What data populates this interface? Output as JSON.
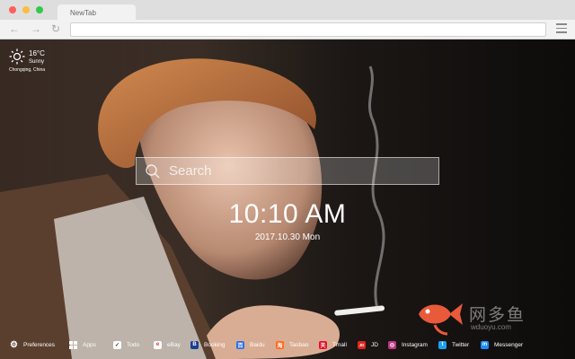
{
  "browser": {
    "tab_title": "NewTab",
    "nav": {
      "back": "←",
      "forward": "→",
      "reload": "↻"
    },
    "url": ""
  },
  "weather": {
    "temperature": "16°C",
    "condition": "Sunny",
    "location": "Chongqing,  China"
  },
  "search": {
    "placeholder": "Search"
  },
  "clock": {
    "time": "10:10 AM",
    "date": "2017.10.30 Mon"
  },
  "watermark": {
    "text": "网多鱼",
    "sub": "wduoyu.com",
    "colors": {
      "fish": "#e85a3a"
    }
  },
  "bottom_bar": {
    "items": [
      {
        "label": "Preferences",
        "icon": "gear-icon",
        "color": "transparent",
        "glyph": "⚙"
      },
      {
        "label": "Apps",
        "icon": "grid-icon",
        "color": "transparent",
        "glyph": ""
      },
      {
        "label": "Todo",
        "icon": "checkbox-icon",
        "color": "#ffffff",
        "glyph": "✓"
      },
      {
        "label": "eBay",
        "icon": "ebay-icon",
        "color": "#ffffff",
        "glyph": "e"
      },
      {
        "label": "Booking",
        "icon": "booking-icon",
        "color": "#1a3f8f",
        "glyph": "B"
      },
      {
        "label": "Baidu",
        "icon": "baidu-icon",
        "color": "#2f6fe0",
        "glyph": "百"
      },
      {
        "label": "Taobao",
        "icon": "taobao-icon",
        "color": "#ff6a1a",
        "glyph": "淘"
      },
      {
        "label": "Tmall",
        "icon": "tmall-icon",
        "color": "#e0102a",
        "glyph": "天"
      },
      {
        "label": "JD",
        "icon": "jd-icon",
        "color": "#e1251b",
        "glyph": "JD"
      },
      {
        "label": "Instagram",
        "icon": "instagram-icon",
        "color": "#c13584",
        "glyph": "◎"
      },
      {
        "label": "Twitter",
        "icon": "twitter-icon",
        "color": "#1da1f2",
        "glyph": "t"
      },
      {
        "label": "Messenger",
        "icon": "messenger-icon",
        "color": "#1a8cff",
        "glyph": "m"
      }
    ]
  }
}
